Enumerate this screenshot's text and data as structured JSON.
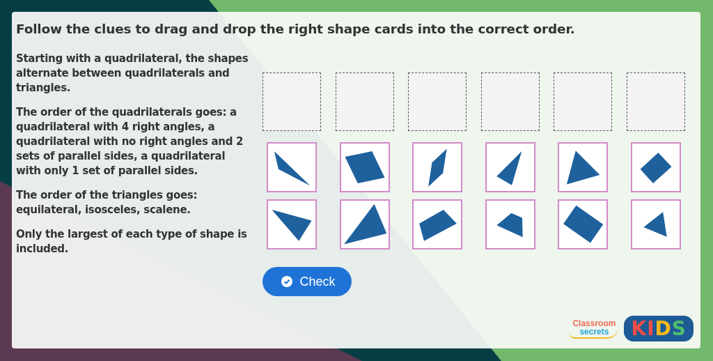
{
  "instruction": "Follow the clues to drag and drop the right shape cards into the correct order.",
  "clues": [
    "Starting with a quadrilateral, the shapes alternate between quadrilaterals and triangles.",
    "The order of the quadrilaterals goes: a quadrilateral with 4 right angles, a quadrilateral with no right angles and 2 sets of parallel sides, a quadrilateral with only 1 set of parallel sides.",
    "The order of the triangles goes: equilateral, isosceles, scalene.",
    "Only the largest of each type of shape is included."
  ],
  "drop_slots": [
    {
      "kind": "empty"
    },
    {
      "kind": "empty"
    },
    {
      "kind": "empty"
    },
    {
      "kind": "empty"
    },
    {
      "kind": "empty"
    },
    {
      "kind": "empty"
    }
  ],
  "cards": [
    {
      "kind": "triangle"
    },
    {
      "kind": "quadrilateral"
    },
    {
      "kind": "quadrilateral"
    },
    {
      "kind": "triangle"
    },
    {
      "kind": "triangle"
    },
    {
      "kind": "quadrilateral"
    },
    {
      "kind": "triangle"
    },
    {
      "kind": "triangle"
    },
    {
      "kind": "quadrilateral"
    },
    {
      "kind": "quadrilateral"
    },
    {
      "kind": "quadrilateral"
    },
    {
      "kind": "triangle"
    }
  ],
  "check_button": "Check",
  "logo": {
    "top": "Classroom",
    "bottom": "secrets",
    "badge": [
      {
        "letter": "K",
        "color": "#f04e45"
      },
      {
        "letter": "I",
        "color": "#f04e45"
      },
      {
        "letter": "D",
        "color": "#f6b81c"
      },
      {
        "letter": "S",
        "color": "#4cbf6b"
      }
    ]
  }
}
